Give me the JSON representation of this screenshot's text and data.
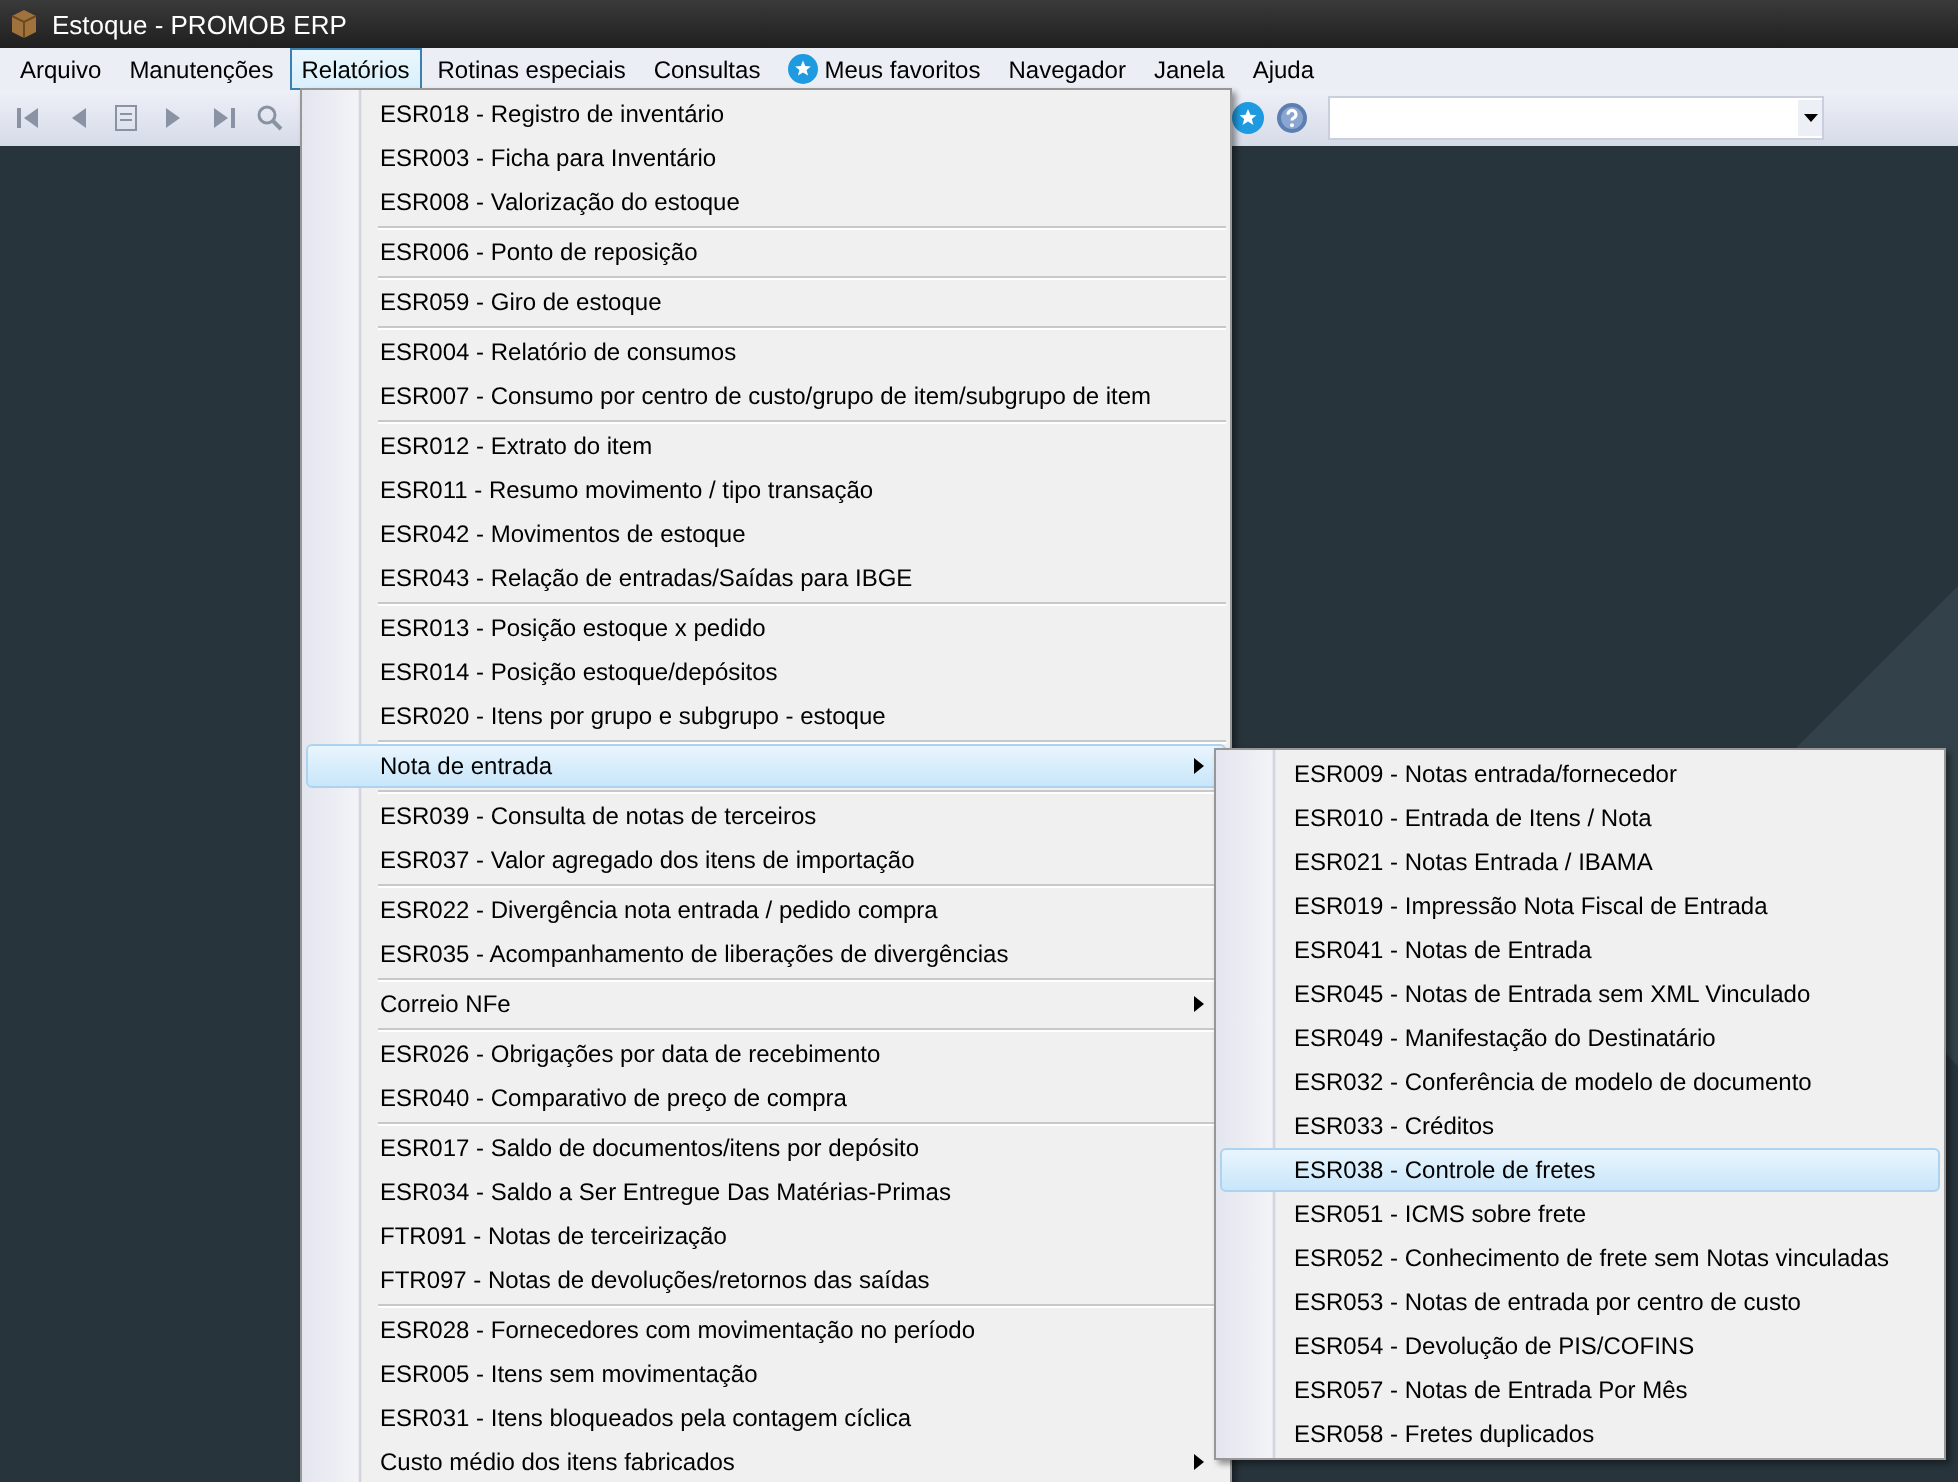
{
  "window": {
    "title": "Estoque - PROMOB ERP"
  },
  "menubar": [
    {
      "label": "Arquivo",
      "selected": false,
      "kind": "plain"
    },
    {
      "label": "Manutenções",
      "selected": false,
      "kind": "plain"
    },
    {
      "label": "Relatórios",
      "selected": true,
      "kind": "plain"
    },
    {
      "label": "Rotinas especiais",
      "selected": false,
      "kind": "plain"
    },
    {
      "label": "Consultas",
      "selected": false,
      "kind": "plain"
    },
    {
      "label": "Meus favoritos",
      "selected": false,
      "kind": "favorite"
    },
    {
      "label": "Navegador",
      "selected": false,
      "kind": "plain"
    },
    {
      "label": "Janela",
      "selected": false,
      "kind": "plain"
    },
    {
      "label": "Ajuda",
      "selected": false,
      "kind": "plain"
    }
  ],
  "dropdown": {
    "groups": [
      [
        {
          "label": "ESR018 - Registro de inventário",
          "kind": "item",
          "selected": false
        },
        {
          "label": "ESR003 - Ficha para Inventário",
          "kind": "item",
          "selected": false
        },
        {
          "label": "ESR008 - Valorização do estoque",
          "kind": "item",
          "selected": false
        }
      ],
      [
        {
          "label": "ESR006 - Ponto de reposição",
          "kind": "item",
          "selected": false
        }
      ],
      [
        {
          "label": "ESR059 - Giro de estoque",
          "kind": "item",
          "selected": false
        }
      ],
      [
        {
          "label": "ESR004 - Relatório de consumos",
          "kind": "item",
          "selected": false
        },
        {
          "label": "ESR007 - Consumo por centro de custo/grupo de item/subgrupo de item",
          "kind": "item",
          "selected": false
        }
      ],
      [
        {
          "label": "ESR012 - Extrato do item",
          "kind": "item",
          "selected": false
        },
        {
          "label": "ESR011 - Resumo movimento / tipo transação",
          "kind": "item",
          "selected": false
        },
        {
          "label": "ESR042 - Movimentos de estoque",
          "kind": "item",
          "selected": false
        },
        {
          "label": "ESR043 - Relação de entradas/Saídas para IBGE",
          "kind": "item",
          "selected": false
        }
      ],
      [
        {
          "label": "ESR013 - Posição estoque x pedido",
          "kind": "item",
          "selected": false
        },
        {
          "label": "ESR014 - Posição estoque/depósitos",
          "kind": "item",
          "selected": false
        },
        {
          "label": "ESR020 - Itens por grupo e subgrupo - estoque",
          "kind": "item",
          "selected": false
        }
      ],
      [
        {
          "label": "Nota de entrada",
          "kind": "submenu",
          "selected": true
        }
      ],
      [
        {
          "label": "ESR039 - Consulta de notas de terceiros",
          "kind": "item",
          "selected": false
        },
        {
          "label": "ESR037 - Valor agregado dos itens de importação",
          "kind": "item",
          "selected": false
        }
      ],
      [
        {
          "label": "ESR022 - Divergência nota entrada / pedido compra",
          "kind": "item",
          "selected": false
        },
        {
          "label": "ESR035 - Acompanhamento de liberações de divergências",
          "kind": "item",
          "selected": false
        }
      ],
      [
        {
          "label": "Correio NFe",
          "kind": "submenu",
          "selected": false
        }
      ],
      [
        {
          "label": "ESR026 - Obrigações por data de recebimento",
          "kind": "item",
          "selected": false
        },
        {
          "label": "ESR040 - Comparativo de preço de compra",
          "kind": "item",
          "selected": false
        }
      ],
      [
        {
          "label": "ESR017 - Saldo de documentos/itens por depósito",
          "kind": "item",
          "selected": false
        },
        {
          "label": "ESR034 - Saldo a Ser Entregue Das Matérias-Primas",
          "kind": "item",
          "selected": false
        },
        {
          "label": "FTR091 - Notas de terceirização",
          "kind": "item",
          "selected": false
        },
        {
          "label": "FTR097 - Notas de devoluções/retornos das saídas",
          "kind": "item",
          "selected": false
        }
      ],
      [
        {
          "label": "ESR028 - Fornecedores com movimentação no período",
          "kind": "item",
          "selected": false
        },
        {
          "label": "ESR005 - Itens sem movimentação",
          "kind": "item",
          "selected": false
        },
        {
          "label": "ESR031 - Itens bloqueados pela contagem cíclica",
          "kind": "item",
          "selected": false
        },
        {
          "label": "Custo médio dos itens fabricados",
          "kind": "submenu",
          "selected": false
        }
      ]
    ]
  },
  "submenu": {
    "items": [
      {
        "label": "ESR009 - Notas entrada/fornecedor",
        "selected": false
      },
      {
        "label": "ESR010 - Entrada de Itens / Nota",
        "selected": false
      },
      {
        "label": "ESR021 - Notas Entrada / IBAMA",
        "selected": false
      },
      {
        "label": "ESR019 - Impressão Nota Fiscal de Entrada",
        "selected": false
      },
      {
        "label": "ESR041 - Notas de Entrada",
        "selected": false
      },
      {
        "label": "ESR045 - Notas de Entrada sem XML Vinculado",
        "selected": false
      },
      {
        "label": "ESR049 - Manifestação do Destinatário",
        "selected": false
      },
      {
        "label": "ESR032 - Conferência de modelo de documento",
        "selected": false
      },
      {
        "label": "ESR033 - Créditos",
        "selected": false
      },
      {
        "label": "ESR038 - Controle de fretes",
        "selected": true
      },
      {
        "label": "ESR051 - ICMS sobre frete",
        "selected": false
      },
      {
        "label": "ESR052 - Conhecimento de frete sem Notas vinculadas",
        "selected": false
      },
      {
        "label": "ESR053 - Notas de entrada por centro de custo",
        "selected": false
      },
      {
        "label": "ESR054 - Devolução de PIS/COFINS",
        "selected": false
      },
      {
        "label": "ESR057 - Notas de Entrada Por Mês",
        "selected": false
      },
      {
        "label": "ESR058 - Fretes duplicados",
        "selected": false
      }
    ]
  }
}
